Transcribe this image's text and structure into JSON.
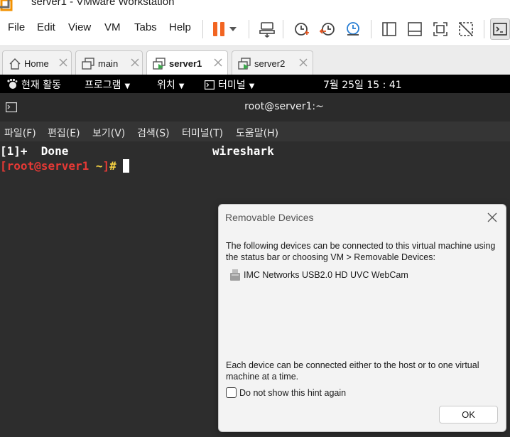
{
  "window": {
    "title": "server1 - VMware Workstation"
  },
  "menu": [
    "File",
    "Edit",
    "View",
    "VM",
    "Tabs",
    "Help"
  ],
  "toolbar": {
    "accent_color": "#f26522",
    "icons": [
      "pause-icon",
      "dropdown-icon",
      "send-keys-icon",
      "snapshot-icon",
      "revert-snapshot-icon",
      "snapshot-manager-icon",
      "sidebar-view-icon",
      "thumbnail-view-icon",
      "fullscreen-icon",
      "unity-icon",
      "console-view-icon"
    ]
  },
  "tabs": [
    {
      "label": "Home",
      "active": false
    },
    {
      "label": "main",
      "active": false
    },
    {
      "label": "server1",
      "active": true
    },
    {
      "label": "server2",
      "active": false
    }
  ],
  "gnome": {
    "activities": "현재 활동",
    "applications": "프로그램",
    "places": "위치",
    "terminal": "터미널",
    "clock": "7월 25일  15 : 41"
  },
  "terminal": {
    "title": "root@server1:~",
    "menu": [
      "파일(F)",
      "편집(E)",
      "보기(V)",
      "검색(S)",
      "터미널(T)",
      "도움말(H)"
    ],
    "lines": {
      "job_prefix": "[1]+  Done",
      "job_name": "wireshark",
      "prompt_open": "[",
      "prompt_user_host": "root@server1",
      "prompt_path": " ~",
      "prompt_close": "]",
      "prompt_symbol": "# "
    },
    "colors": {
      "prompt_red": "#e53935",
      "prompt_yellow": "#f5d142",
      "background": "#2d2d2d"
    }
  },
  "dialog": {
    "title": "Removable Devices",
    "intro": "The following devices can be connected to this virtual machine using the status bar or choosing VM > Removable Devices:",
    "device": "IMC Networks USB2.0 HD UVC WebCam",
    "note": "Each device can be connected either to the host or to one virtual machine at a time.",
    "checkbox_label": "Do not show this hint again",
    "checkbox_checked": false,
    "ok_label": "OK"
  }
}
